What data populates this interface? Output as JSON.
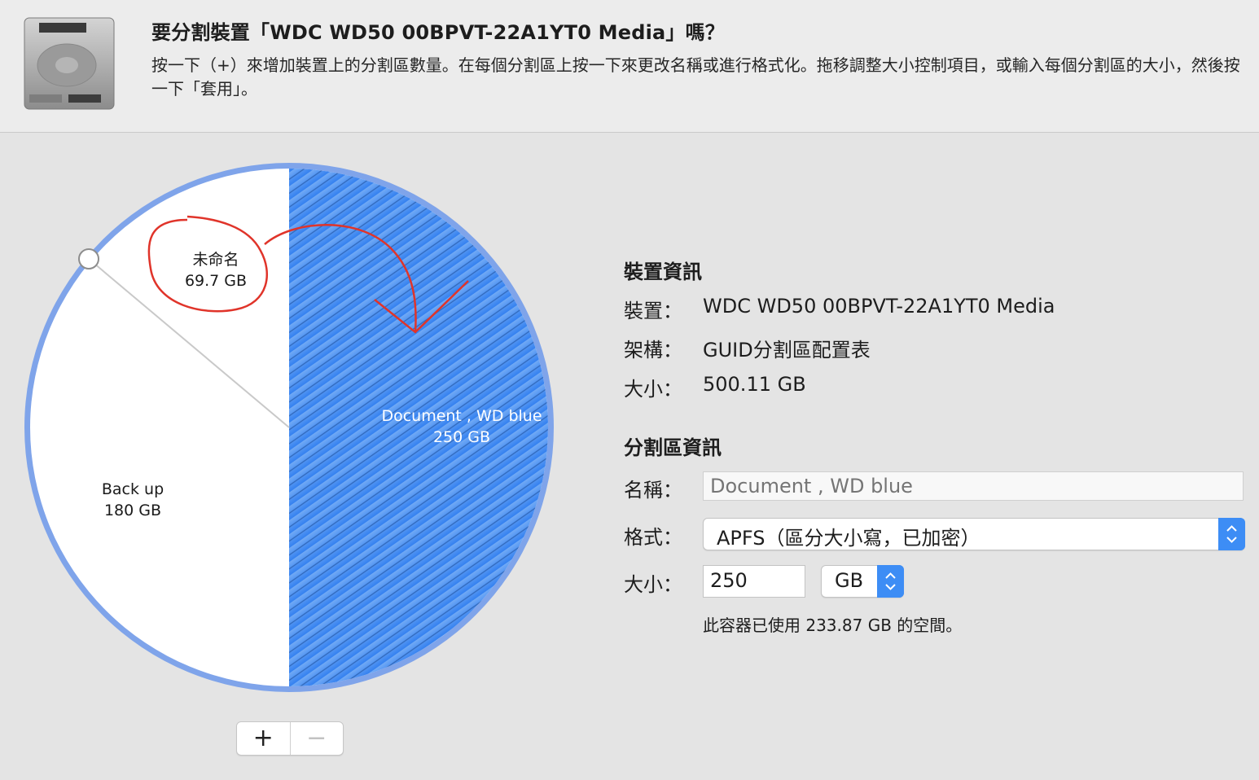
{
  "header": {
    "title": "要分割裝置「WDC WD50 00BPVT-22A1YT0 Media」嗎？",
    "description": "按一下（+）來增加裝置上的分割區數量。在每個分割區上按一下來更改名稱或進行格式化。拖移調整大小控制項目，或輸入每個分割區的大小，然後按一下「套用」。",
    "icon": "hard-disk-icon"
  },
  "chart_data": {
    "type": "pie",
    "slices": [
      {
        "name": "Document , WD blue",
        "size_label": "250 GB",
        "value": 250,
        "color": "#3d8df5",
        "selected": true
      },
      {
        "name": "Back up",
        "size_label": "180 GB",
        "value": 180,
        "color": "#ffffff",
        "selected": false
      },
      {
        "name": "未命名",
        "size_label": "69.7 GB",
        "value": 69.7,
        "color": "#ffffff",
        "selected": false
      }
    ]
  },
  "controls": {
    "add_label": "+",
    "remove_label": "−"
  },
  "device_info": {
    "section_title": "裝置資訊",
    "device_label": "裝置：",
    "device_value": "WDC WD50 00BPVT-22A1YT0 Media",
    "scheme_label": "架構：",
    "scheme_value": "GUID分割區配置表",
    "size_label": "大小：",
    "size_value": "500.11 GB"
  },
  "partition_info": {
    "section_title": "分割區資訊",
    "name_label": "名稱：",
    "name_placeholder": "Document , WD blue",
    "format_label": "格式：",
    "format_value": "APFS（區分大小寫，已加密）",
    "size_label": "大小：",
    "size_value": "250",
    "unit_value": "GB",
    "usage_note": "此容器已使用 233.87 GB 的空間。"
  },
  "colors": {
    "accent": "#3d8df5",
    "pie_ring": "#7fa4ea",
    "annotation": "#e0342a"
  }
}
